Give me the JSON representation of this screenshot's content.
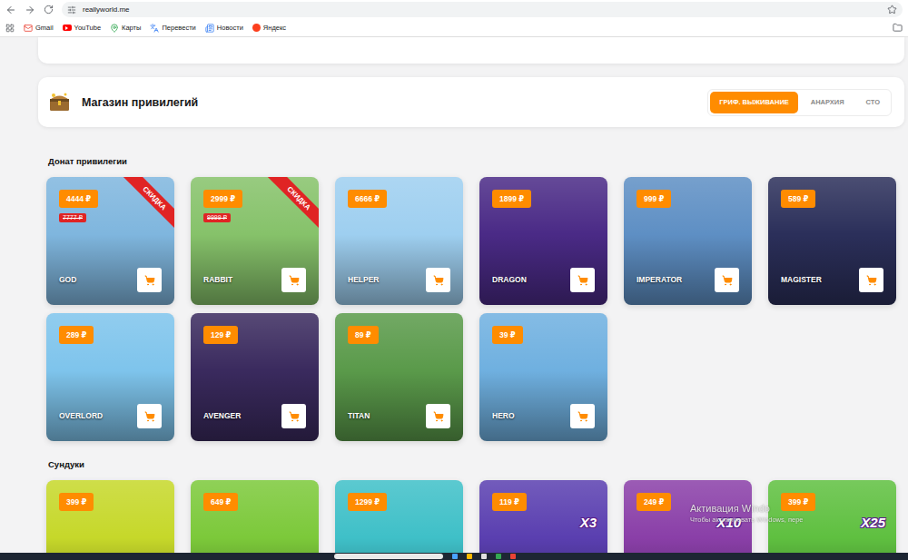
{
  "browser": {
    "url": "reallyworld.me",
    "bookmarks": [
      "Gmail",
      "YouTube",
      "Карты",
      "Перевести",
      "Новости",
      "Яндекс"
    ]
  },
  "shop": {
    "title": "Магазин привилегий",
    "tabs": [
      {
        "label": "ГРИФ. ВЫЖИВАНИЕ",
        "selected": true
      },
      {
        "label": "АНАРХИЯ",
        "selected": false
      },
      {
        "label": "СТО",
        "selected": false
      }
    ]
  },
  "privileges": {
    "heading": "Донат привилегии",
    "items": [
      {
        "name": "GOD",
        "price": "4444 ₽",
        "old_price": "7777 ₽",
        "ribbon": "СКИДКА",
        "color": "#7fb6de"
      },
      {
        "name": "RABBIT",
        "price": "2999 ₽",
        "old_price": "9999 ₽",
        "ribbon": "СКИДКА",
        "color": "#86c26a"
      },
      {
        "name": "HELPER",
        "price": "6666 ₽",
        "color": "#9ecff0"
      },
      {
        "name": "DRAGON",
        "price": "1899 ₽",
        "color": "#4a2a86"
      },
      {
        "name": "IMPERATOR",
        "price": "999 ₽",
        "color": "#5e8fc4"
      },
      {
        "name": "MAGISTER",
        "price": "589 ₽",
        "color": "#2b2f5a"
      },
      {
        "name": "OVERLORD",
        "price": "289 ₽",
        "color": "#7ec4ec"
      },
      {
        "name": "AVENGER",
        "price": "129 ₽",
        "color": "#3a2a5e"
      },
      {
        "name": "TITAN",
        "price": "89 ₽",
        "color": "#5a9a4a"
      },
      {
        "name": "HERO",
        "price": "39 ₽",
        "color": "#6fb0e0"
      }
    ]
  },
  "chests": {
    "heading": "Сундуки",
    "items": [
      {
        "price": "399 ₽",
        "color": "#c6d82a"
      },
      {
        "price": "649 ₽",
        "color": "#7cc93a"
      },
      {
        "price": "1299 ₽",
        "color": "#3fc0c8"
      },
      {
        "price": "119 ₽",
        "multiplier": "X3",
        "color": "#5a3fb0"
      },
      {
        "price": "249 ₽",
        "multiplier": "X10",
        "color": "#8a3fa8"
      },
      {
        "price": "399 ₽",
        "multiplier": "X25",
        "color": "#5fc040"
      }
    ]
  },
  "watermark": {
    "title": "Активация Windo",
    "subtitle": "Чтобы активировать Windows, пере"
  }
}
